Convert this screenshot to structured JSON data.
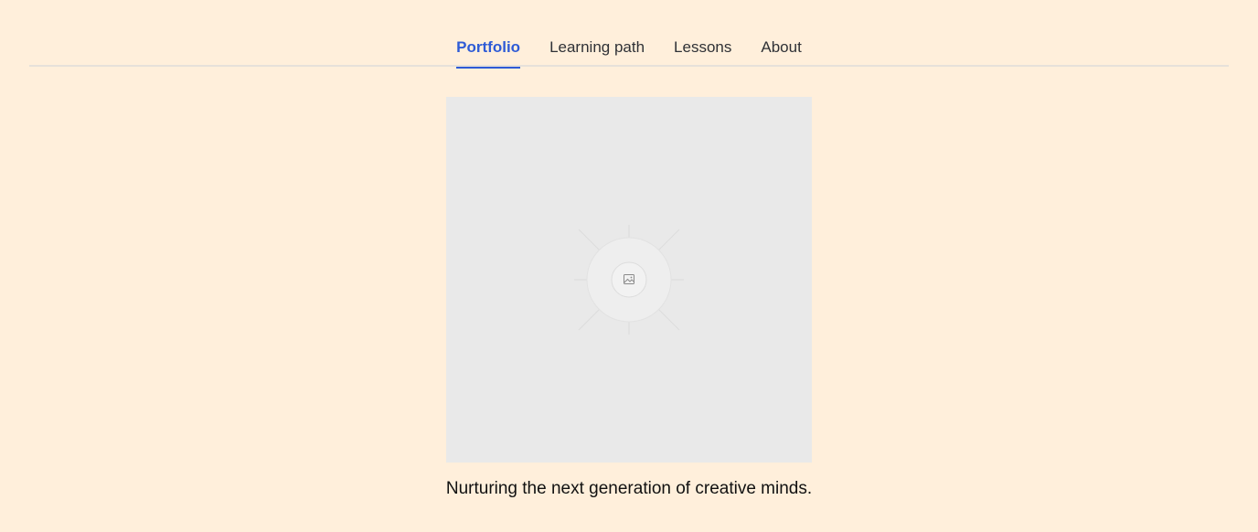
{
  "nav": {
    "tabs": [
      {
        "label": "Portfolio",
        "active": true
      },
      {
        "label": "Learning path",
        "active": false
      },
      {
        "label": "Lessons",
        "active": false
      },
      {
        "label": "About",
        "active": false
      }
    ],
    "active_color": "#2e5bd6"
  },
  "hero": {
    "image_icon": "image-icon",
    "caption": "Nurturing the next generation of creative minds."
  },
  "colors": {
    "background": "#ffefdb",
    "placeholder": "#e9e9e9"
  }
}
